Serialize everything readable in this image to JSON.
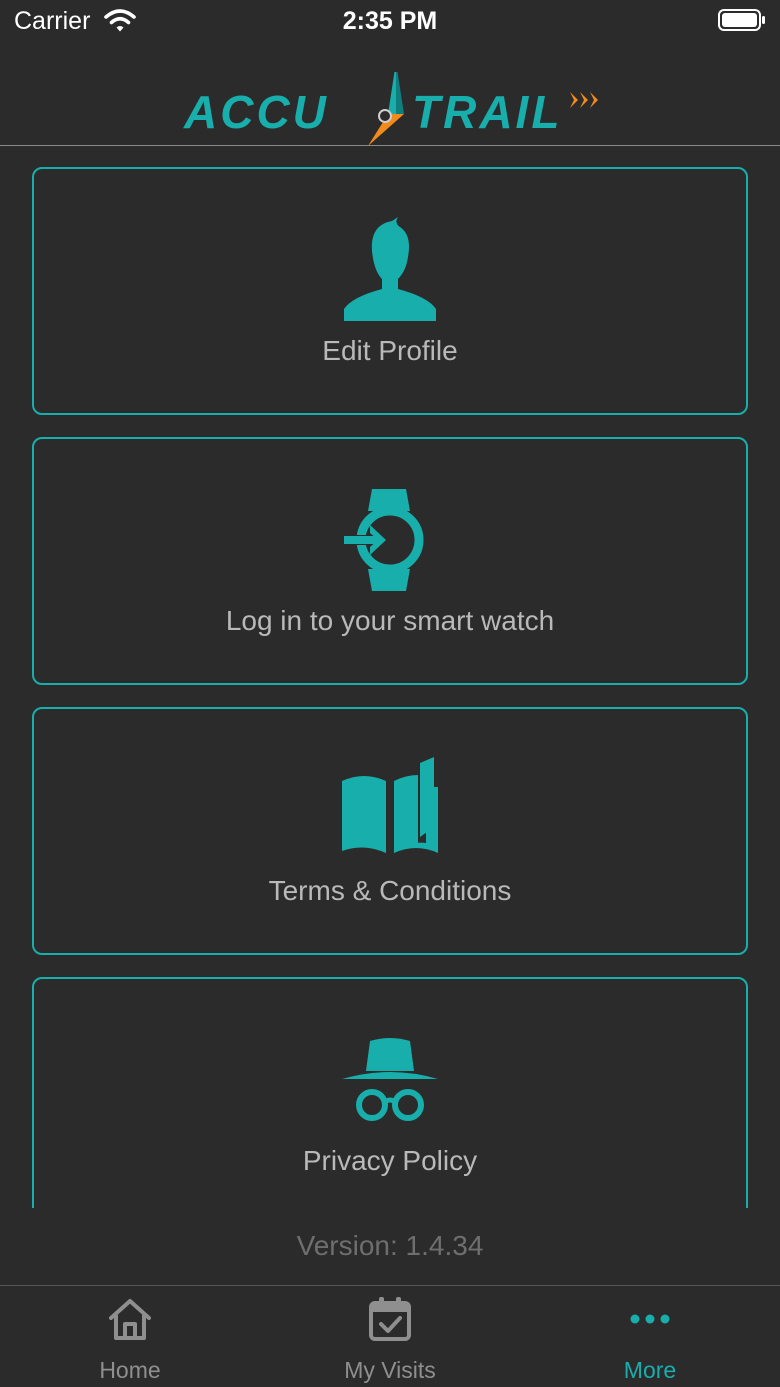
{
  "status_bar": {
    "carrier": "Carrier",
    "time": "2:35 PM"
  },
  "header": {
    "logo_left": "ACCU",
    "logo_right": "TRAIL",
    "colors": {
      "teal": "#18aeac",
      "orange": "#f28a1c"
    }
  },
  "menu": {
    "items": [
      {
        "label": "Edit Profile",
        "icon": "user-profile-icon"
      },
      {
        "label": "Log in to your smart watch",
        "icon": "smartwatch-login-icon"
      },
      {
        "label": "Terms & Conditions",
        "icon": "open-book-icon"
      },
      {
        "label": "Privacy Policy",
        "icon": "incognito-icon"
      }
    ]
  },
  "version": "Version: 1.4.34",
  "tab_bar": {
    "tabs": [
      {
        "label": "Home",
        "icon": "home-icon",
        "active": false
      },
      {
        "label": "My Visits",
        "icon": "calendar-check-icon",
        "active": false
      },
      {
        "label": "More",
        "icon": "more-dots-icon",
        "active": true
      }
    ]
  },
  "theme": {
    "background": "#2b2b2b",
    "accent": "#18aeac",
    "label_color": "#b9b9b9",
    "inactive_tab": "#8f8f8f"
  }
}
